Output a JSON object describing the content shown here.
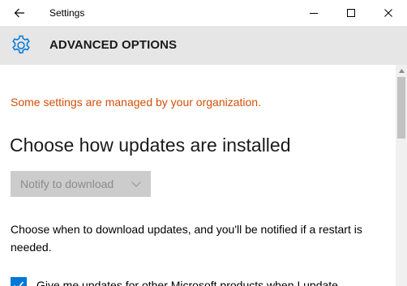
{
  "window": {
    "title": "Settings"
  },
  "header": {
    "title": "ADVANCED OPTIONS",
    "icon": "gear-icon",
    "icon_color": "#0078d7"
  },
  "content": {
    "managed_notice": "Some settings are managed by your organization.",
    "heading": "Choose how updates are installed",
    "install_mode_dropdown": {
      "selected": "Notify to download",
      "disabled": true
    },
    "description": "Choose when to download updates, and you'll be notified if a restart is needed.",
    "other_products_checkbox": {
      "label": "Give me updates for other Microsoft products when I update",
      "checked": true
    }
  },
  "colors": {
    "accent": "#0078d7",
    "warning_text": "#d14f07",
    "header_bg": "#e6e6e6"
  }
}
